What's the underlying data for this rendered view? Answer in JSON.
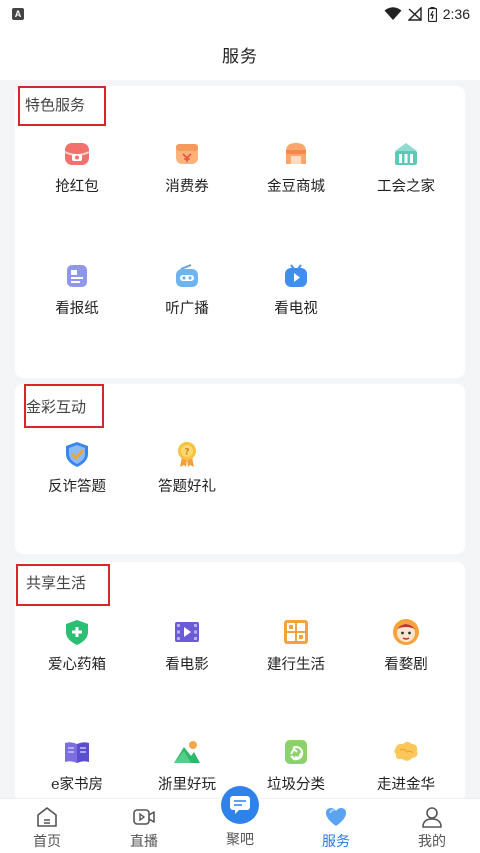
{
  "status_bar": {
    "notification_icon": "A",
    "time": "2:36"
  },
  "header": {
    "title": "服务"
  },
  "sections": [
    {
      "title": "特色服务",
      "items": [
        {
          "label": "抢红包",
          "icon": "red-packet-icon"
        },
        {
          "label": "消费券",
          "icon": "coupon-icon"
        },
        {
          "label": "金豆商城",
          "icon": "shop-icon"
        },
        {
          "label": "工会之家",
          "icon": "union-building-icon"
        },
        {
          "label": "看报纸",
          "icon": "newspaper-icon"
        },
        {
          "label": "听广播",
          "icon": "radio-icon"
        },
        {
          "label": "看电视",
          "icon": "tv-icon"
        }
      ]
    },
    {
      "title": "金彩互动",
      "items": [
        {
          "label": "反诈答题",
          "icon": "shield-check-icon"
        },
        {
          "label": "答题好礼",
          "icon": "award-medal-icon"
        }
      ]
    },
    {
      "title": "共享生活",
      "items": [
        {
          "label": "爱心药箱",
          "icon": "medicine-shield-icon"
        },
        {
          "label": "看电影",
          "icon": "film-icon"
        },
        {
          "label": "建行生活",
          "icon": "ccb-life-icon"
        },
        {
          "label": "看婺剧",
          "icon": "opera-mask-icon"
        },
        {
          "label": "e家书房",
          "icon": "book-icon"
        },
        {
          "label": "浙里好玩",
          "icon": "mountain-icon"
        },
        {
          "label": "垃圾分类",
          "icon": "recycle-icon"
        },
        {
          "label": "走进金华",
          "icon": "jinhua-map-icon"
        }
      ]
    }
  ],
  "bottom_nav": {
    "items": [
      {
        "label": "首页",
        "icon": "home-icon"
      },
      {
        "label": "直播",
        "icon": "video-camera-icon"
      },
      {
        "label": "聚吧",
        "icon": "chat-bubble-icon"
      },
      {
        "label": "服务",
        "icon": "heart-icon",
        "active": true
      },
      {
        "label": "我的",
        "icon": "user-icon"
      }
    ]
  },
  "colors": {
    "accent": "#2877e6",
    "highlight_border": "#d9262c",
    "background": "#f4f5f7"
  }
}
